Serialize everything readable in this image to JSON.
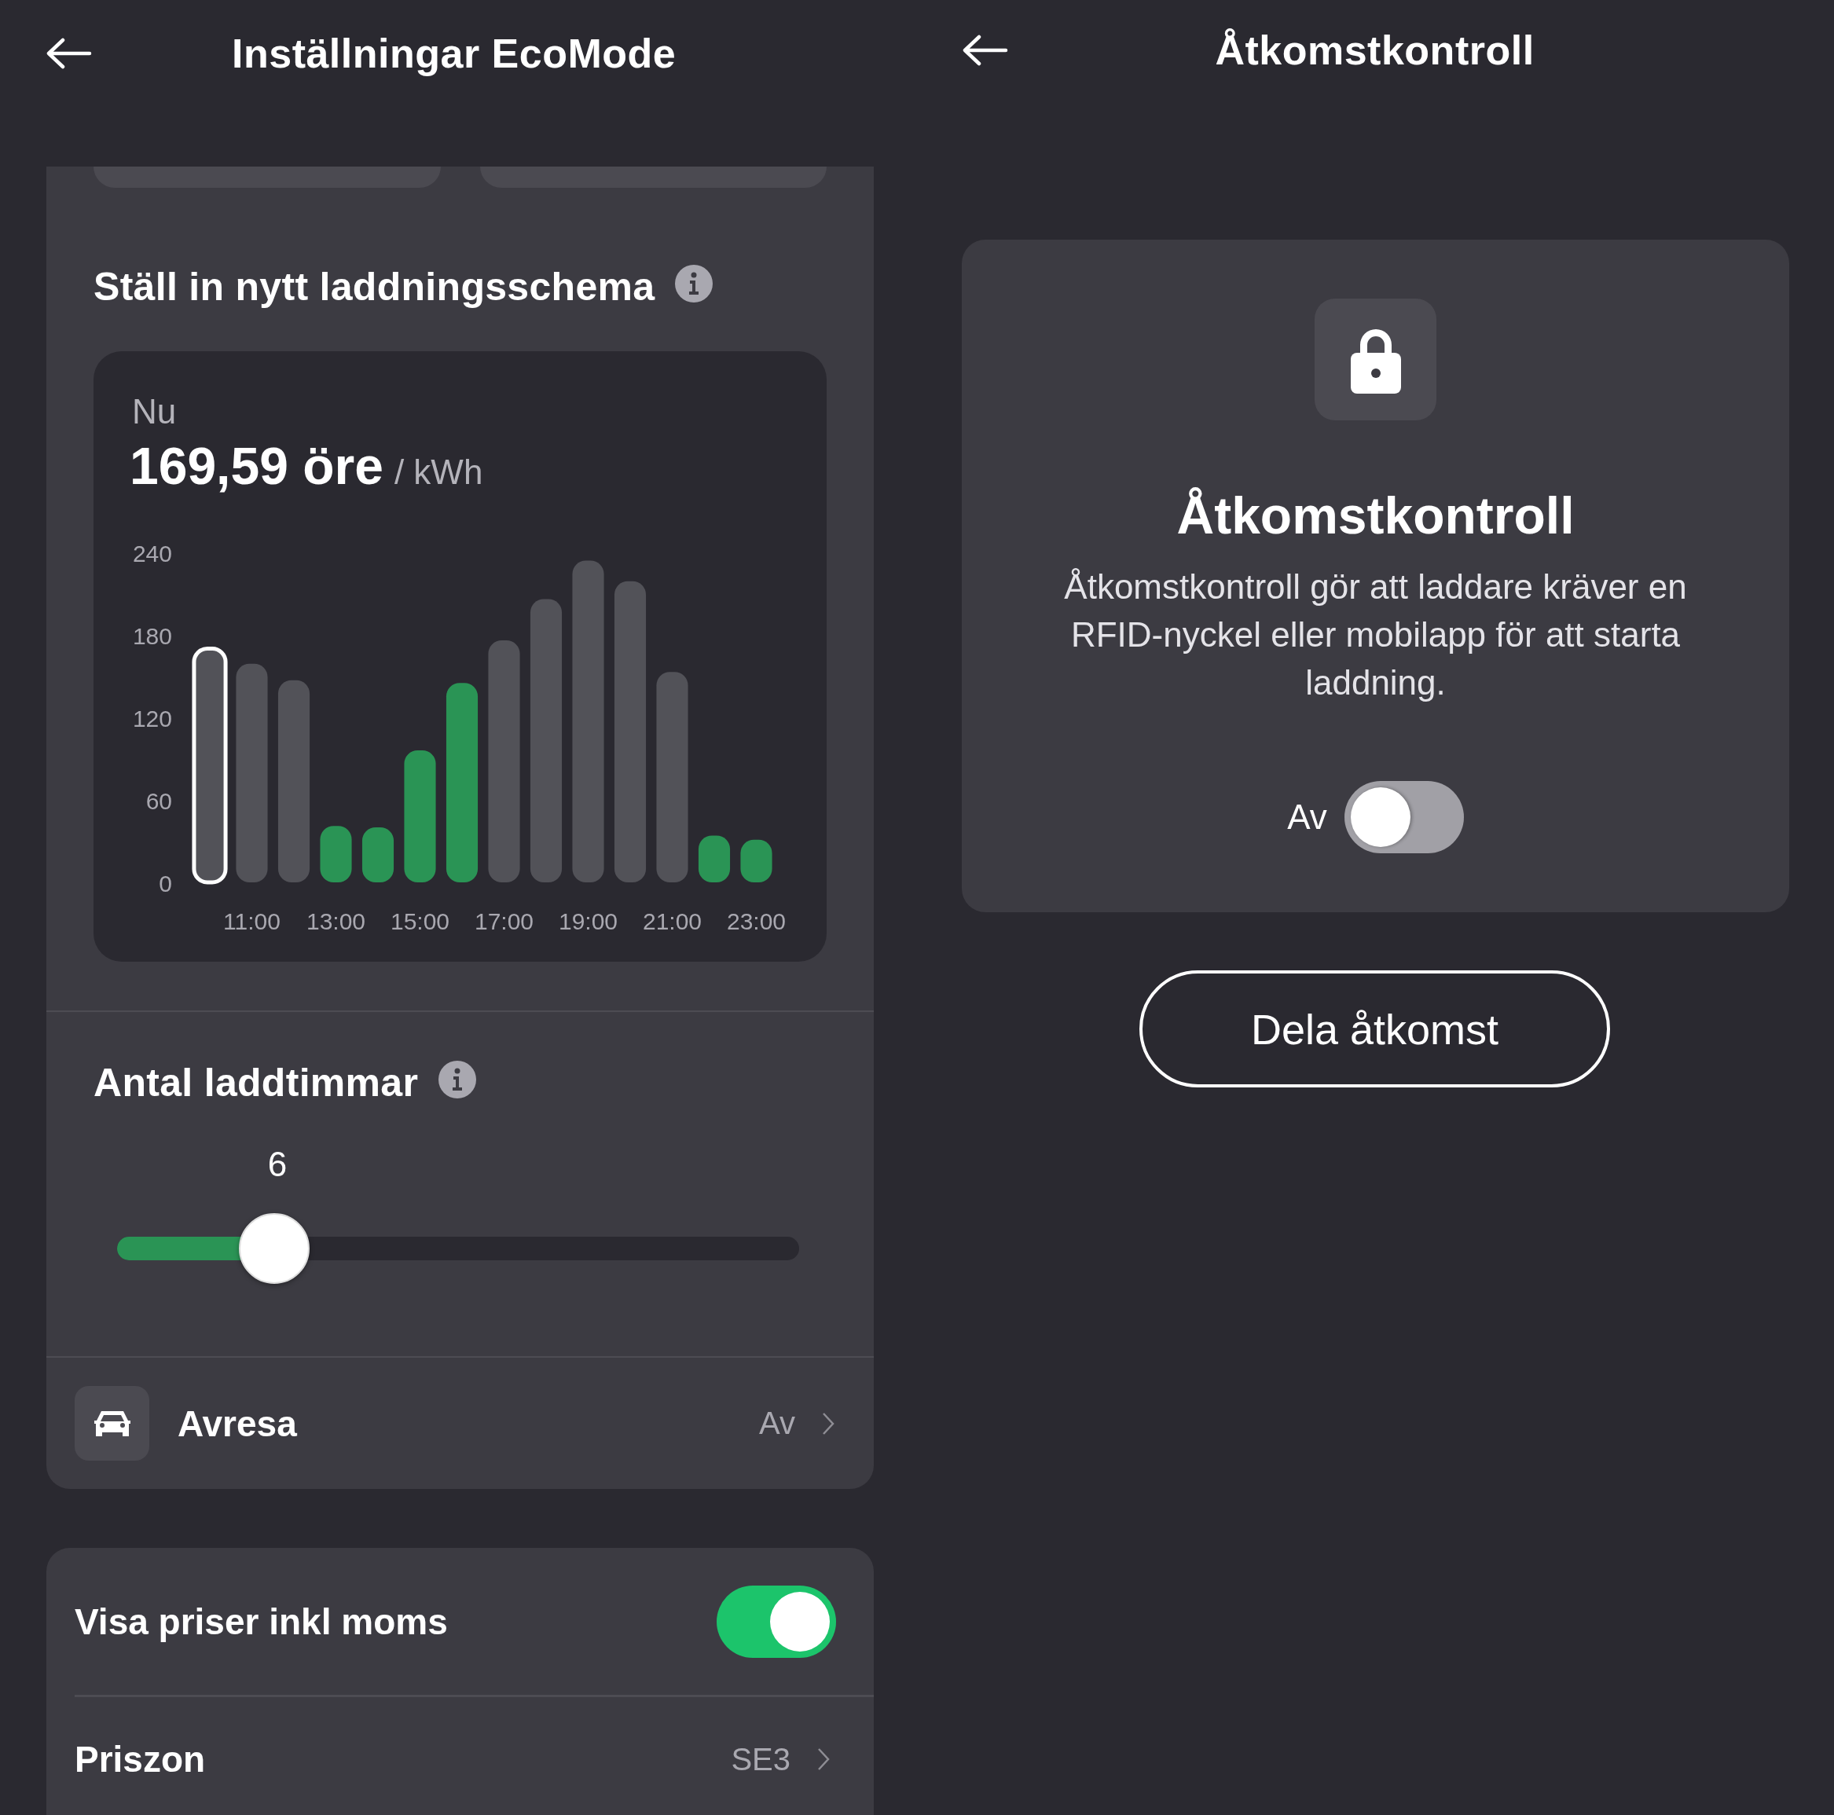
{
  "eco_settings": {
    "title": "Inställningar EcoMode",
    "schedule": {
      "title": "Ställ in nytt laddningsschema",
      "price_label": "Nu",
      "price": "169,59 öre",
      "unit": "/ kWh",
      "chart_data": {
        "type": "bar",
        "x": [
          10,
          11,
          12,
          13,
          14,
          15,
          16,
          17,
          18,
          19,
          20,
          21,
          22,
          23
        ],
        "series": [
          {
            "color": "#525258",
            "values": [
              170,
              159,
              147,
              null,
              null,
              null,
              null,
              176,
              206,
              234,
              219,
              153,
              null,
              null
            ]
          },
          {
            "color": "#2a9455",
            "values": [
              null,
              null,
              null,
              41,
              40,
              96,
              145,
              null,
              null,
              null,
              null,
              null,
              34,
              31
            ]
          }
        ],
        "stacked": true,
        "xlim": [
          9.5,
          23.5
        ],
        "ylim": [
          0,
          240
        ],
        "yticks": [
          0,
          60,
          120,
          180,
          240
        ],
        "xticks": [
          {
            "value": 11,
            "label": "11:00"
          },
          {
            "value": 13,
            "label": "13:00"
          },
          {
            "value": 15,
            "label": "15:00"
          },
          {
            "value": 17,
            "label": "17:00"
          },
          {
            "value": 19,
            "label": "19:00"
          },
          {
            "value": 21,
            "label": "21:00"
          },
          {
            "value": 23,
            "label": "23:00"
          }
        ]
      },
      "bars": [
        {
          "selected": true
        },
        {
          "selected": false
        },
        {
          "selected": false
        },
        {
          "selected": false
        },
        {
          "selected": false
        },
        {
          "selected": false
        },
        {
          "selected": false
        },
        {
          "selected": false
        },
        {
          "selected": false
        },
        {
          "selected": false
        },
        {
          "selected": false
        },
        {
          "selected": false
        },
        {
          "selected": false
        },
        {
          "selected": false
        }
      ]
    },
    "hours": {
      "title": "Antal laddtimmar",
      "value": "6",
      "level": 0.23
    },
    "departure": {
      "label": "Avresa",
      "value": "Av"
    },
    "vat": {
      "label": "Visa priser inkl moms",
      "on": true
    },
    "price_zone": {
      "label": "Priszon",
      "value": "SE3"
    }
  },
  "access_control": {
    "title": "Åtkomstkontroll",
    "card": {
      "heading": "Åtkomstkontroll",
      "description": "Åtkomstkontroll gör att laddare kräver en RFID-nyckel eller mobilapp för att starta laddning.",
      "toggle_label": "Av",
      "on": false
    },
    "share_button": "Dela åtkomst"
  }
}
